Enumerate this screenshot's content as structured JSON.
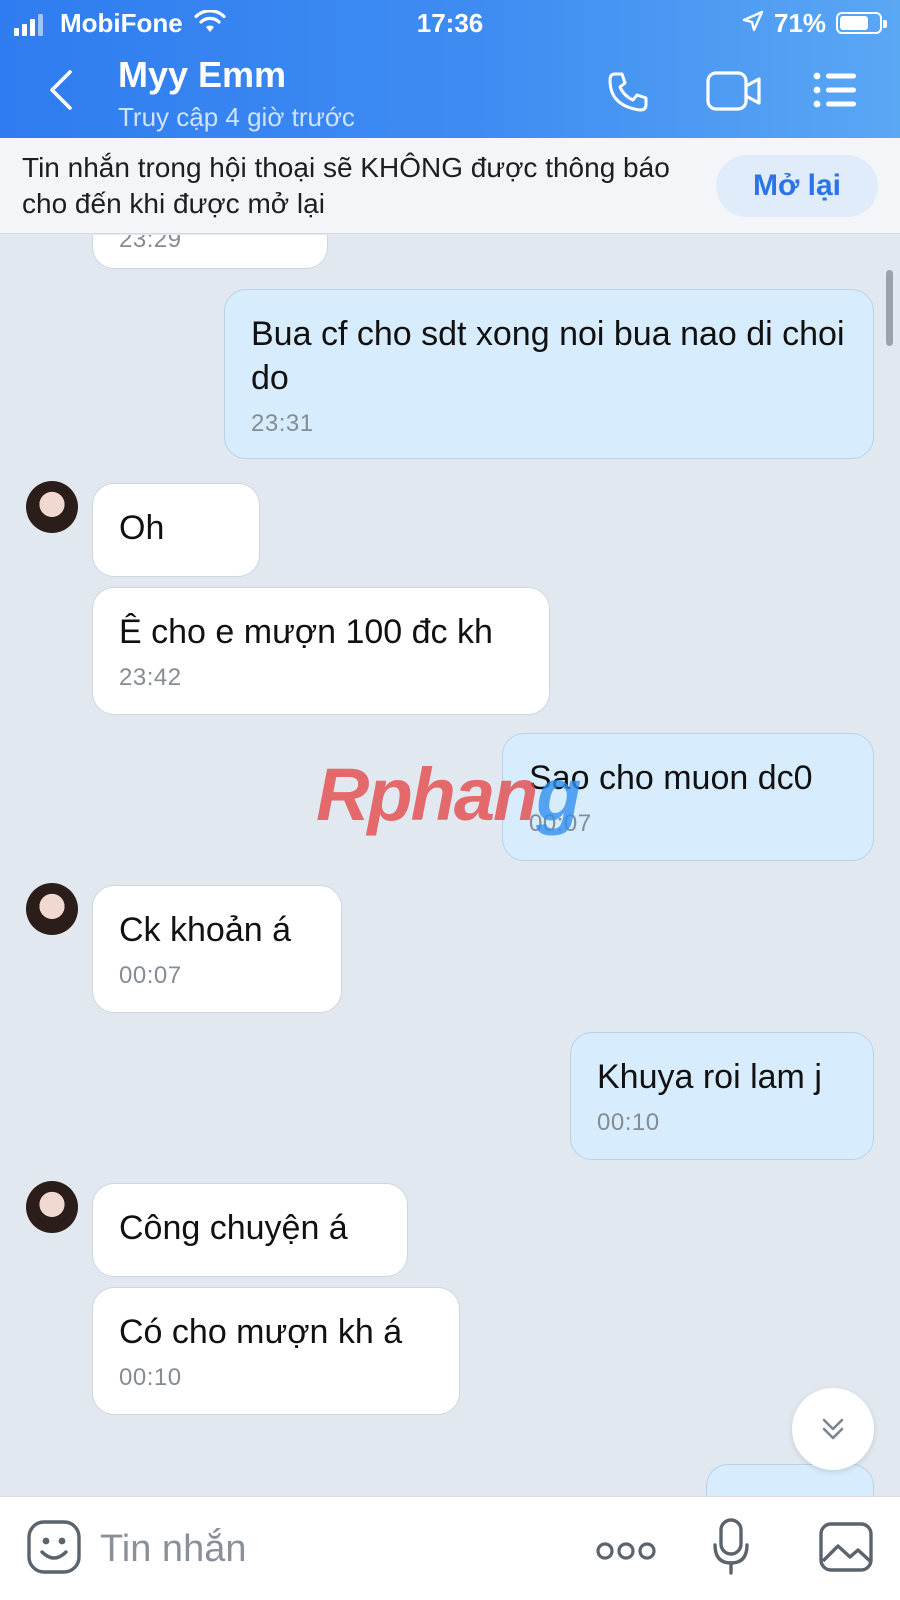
{
  "status_bar": {
    "carrier": "MobiFone",
    "time": "17:36",
    "battery": "71%"
  },
  "header": {
    "name": "Myy Emm",
    "subtitle": "Truy cập 4 giờ trước"
  },
  "banner": {
    "text": "Tin nhắn trong hội thoại sẽ KHÔNG được thông báo cho đến khi được mở lại",
    "button": "Mở lại"
  },
  "messages": [
    {
      "time": "23:29"
    },
    {
      "text": "Bua cf cho sdt xong noi bua nao di choi do",
      "time": "23:31"
    },
    {
      "text": "Oh"
    },
    {
      "text": "Ê cho e mượn 100 đc kh",
      "time": "23:42"
    },
    {
      "text": "Sao cho muon dc0",
      "time": "00:07"
    },
    {
      "text": "Ck khoản á",
      "time": "00:07"
    },
    {
      "text": "Khuya roi lam j",
      "time": "00:10"
    },
    {
      "text": "Công chuyện á"
    },
    {
      "text": "Có cho mượn kh á",
      "time": "00:10"
    }
  ],
  "watermark": {
    "part1": "Rphan",
    "part2": "g"
  },
  "composer": {
    "placeholder": "Tin nhắn"
  },
  "icons": [
    "back-chevron-icon",
    "phone-icon",
    "video-call-icon",
    "menu-list-icon",
    "sticker-icon",
    "more-dots-icon",
    "microphone-icon",
    "image-icon",
    "chevron-double-down-icon"
  ],
  "colors": {
    "header_start": "#2f7cf0",
    "header_end": "#5aa7f4",
    "outgoing_bubble": "#d7ecfd",
    "chat_bg": "#e2e8f0",
    "accent": "#2a74e8"
  }
}
